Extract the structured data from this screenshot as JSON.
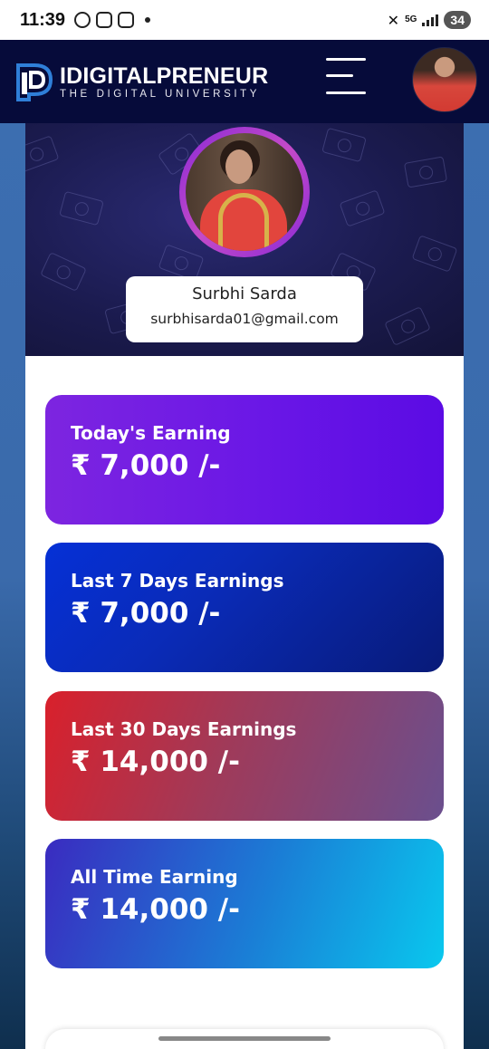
{
  "status_bar": {
    "time": "11:39",
    "network": "5G",
    "battery": "34"
  },
  "header": {
    "brand_name": "IDIGITALPRENEUR",
    "brand_tagline": "THE DIGITAL UNIVERSITY"
  },
  "profile": {
    "name": "Surbhi Sarda",
    "email": "surbhisarda01@gmail.com"
  },
  "earnings": [
    {
      "label": "Today's Earning",
      "value": "₹ 7,000 /-"
    },
    {
      "label": "Last 7 Days Earnings",
      "value": "₹ 7,000 /-"
    },
    {
      "label": "Last 30 Days Earnings",
      "value": "₹ 14,000 /-"
    },
    {
      "label": "All Time Earning",
      "value": "₹ 14,000 /-"
    }
  ],
  "colors": {
    "header_bg": "#060b3a",
    "page_bg": "#3c6fb2",
    "card_today": "#6a17e6",
    "card_7days": "#0a2bb8",
    "card_30days": "#a03a59",
    "card_alltime": "#1a7fd6"
  }
}
